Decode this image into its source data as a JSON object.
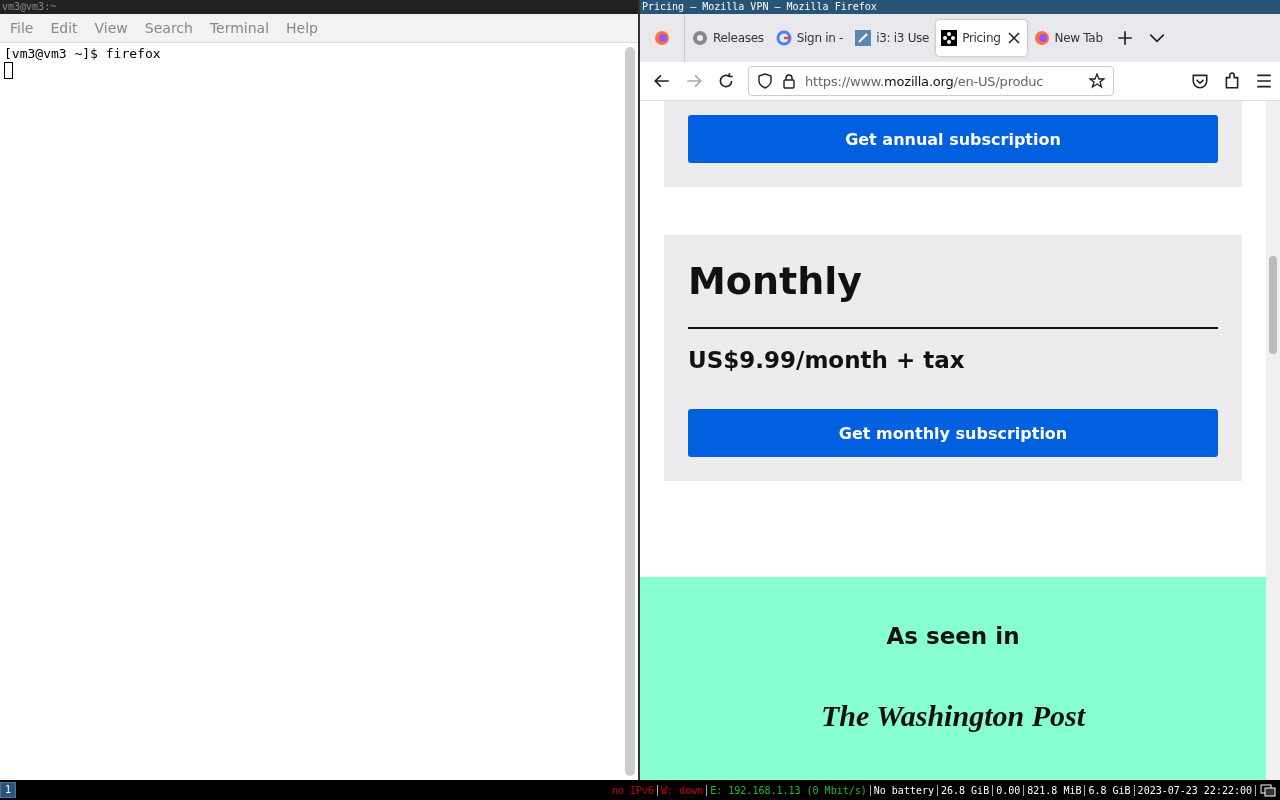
{
  "terminal": {
    "title": "vm3@vm3:~",
    "menu": [
      "File",
      "Edit",
      "View",
      "Search",
      "Terminal",
      "Help"
    ],
    "lines": [
      "[vm3@vm3 ~]$ firefox"
    ]
  },
  "browser": {
    "title": "Pricing — Mozilla VPN — Mozilla Firefox",
    "tabs": [
      {
        "label": "Releases",
        "selected": false
      },
      {
        "label": "Sign in -",
        "selected": false
      },
      {
        "label": "i3: i3 Use",
        "selected": false
      },
      {
        "label": "Pricing",
        "selected": true
      },
      {
        "label": "New Tab",
        "selected": false
      }
    ],
    "url": {
      "prefix": "https://www.",
      "domain": "mozilla.org",
      "path": "/en-US/produc"
    },
    "page": {
      "annual_button": "Get annual subscription",
      "plan_title": "Monthly",
      "plan_price": "US$9.99/month + tax",
      "monthly_button": "Get monthly subscription",
      "press_heading": "As seen in",
      "press_logo": "The Washington Post"
    }
  },
  "status_bar": {
    "workspaces": [
      {
        "label": "1",
        "selected": true
      }
    ],
    "items": [
      {
        "text": "no IPv6",
        "color": "#cc0000"
      },
      {
        "text": "W: down",
        "color": "#cc0000"
      },
      {
        "text": "E: 192.168.1.13 (0 Mbit/s)",
        "color": "#22bb22"
      },
      {
        "text": "No battery",
        "color": "#ffffff"
      },
      {
        "text": "26.8 GiB",
        "color": "#ffffff"
      },
      {
        "text": "0.00",
        "color": "#ffffff"
      },
      {
        "text": "821.8 MiB",
        "color": "#ffffff"
      },
      {
        "text": "6.8 GiB",
        "color": "#ffffff"
      },
      {
        "text": "2023-07-23 22:22:00",
        "color": "#ffffff"
      }
    ]
  }
}
